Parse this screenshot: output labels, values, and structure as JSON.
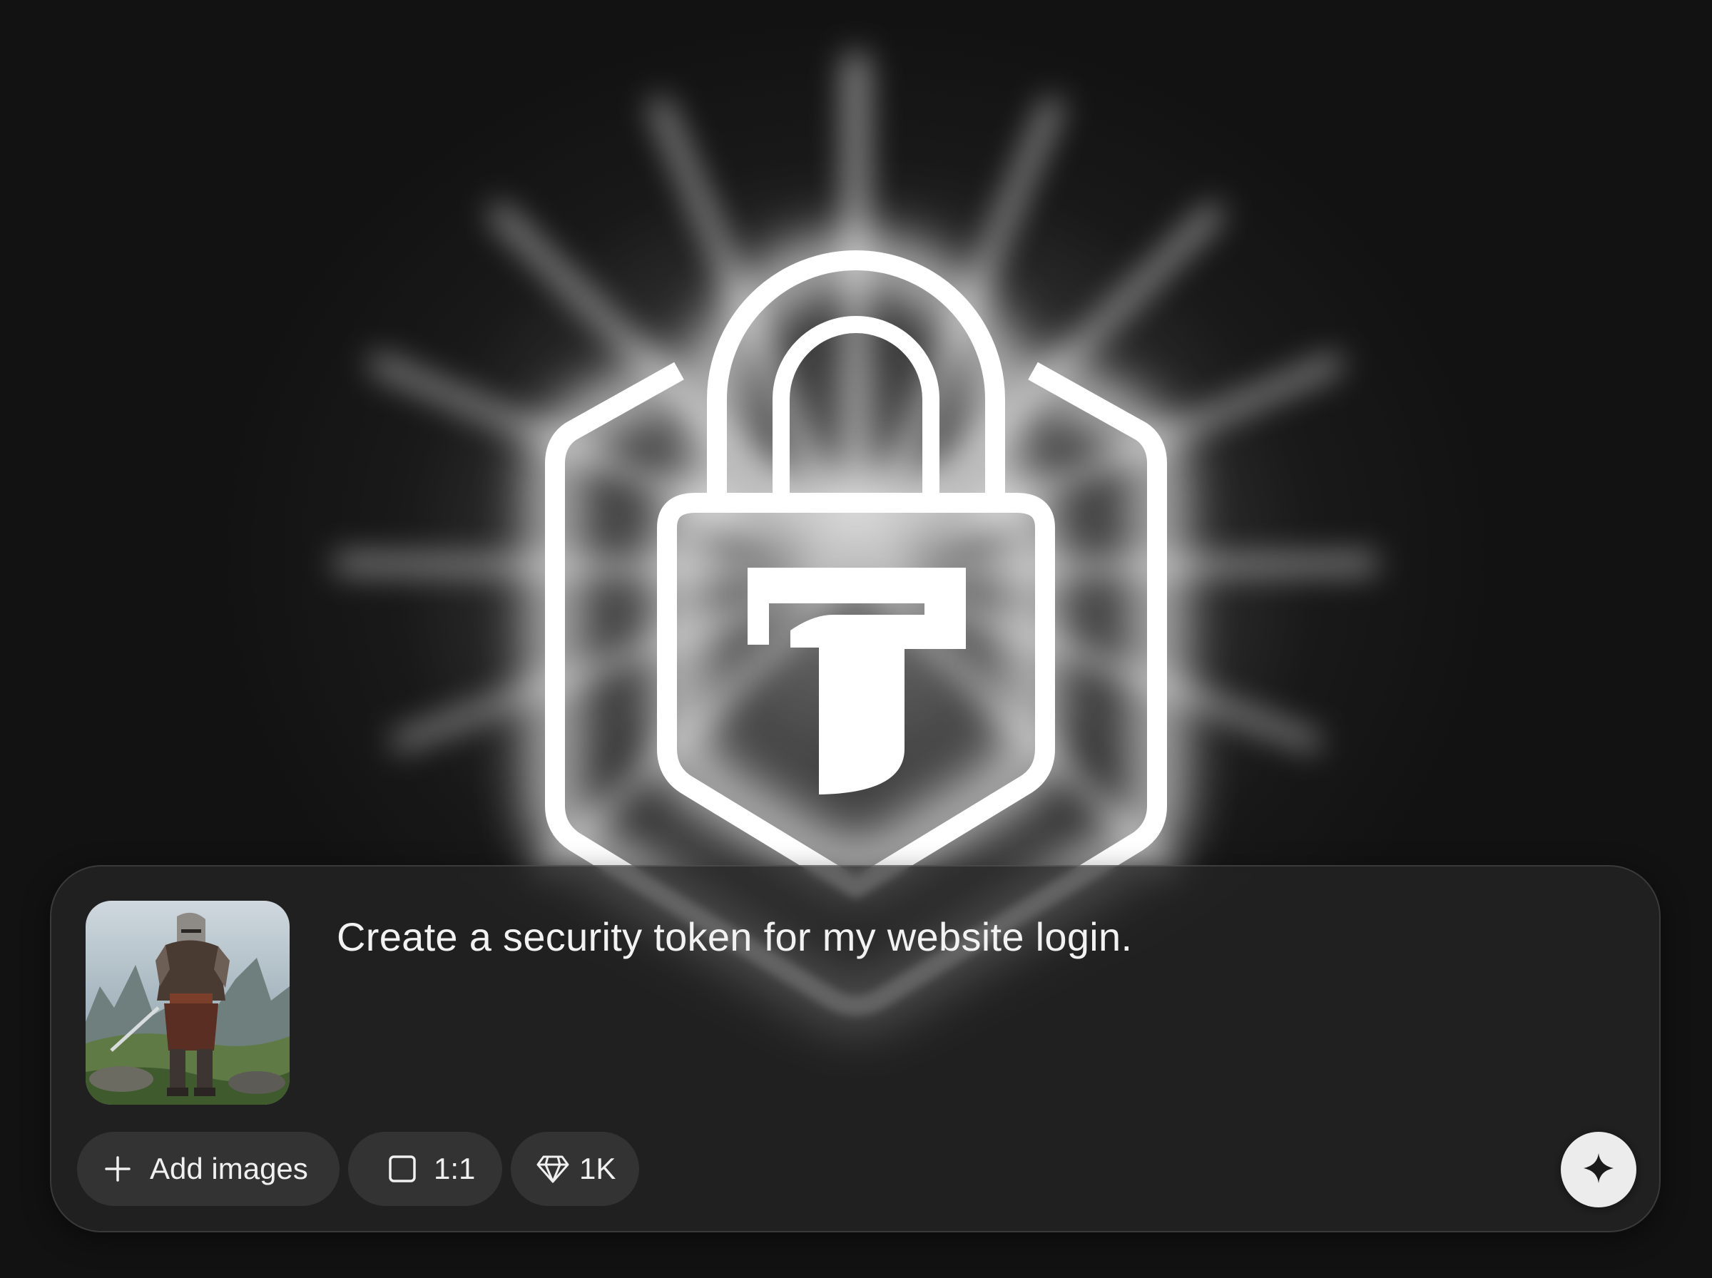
{
  "prompt": {
    "text": "Create a security token for my website login."
  },
  "attachment": {
    "icon": "knight-thumbnail-image"
  },
  "toolbar": {
    "add_images_label": "Add images",
    "add_images_icon": "plus-icon",
    "ratio_label": "1:1",
    "ratio_icon": "square-icon",
    "quality_label": "1K",
    "quality_icon": "diamond-icon",
    "generate_icon": "sparkle-icon"
  },
  "colors": {
    "background": "#141414",
    "glow": "#ffffff",
    "panel": "#262626",
    "pill": "#333333",
    "generate_button": "#ececec",
    "text": "#f2f2f2"
  }
}
